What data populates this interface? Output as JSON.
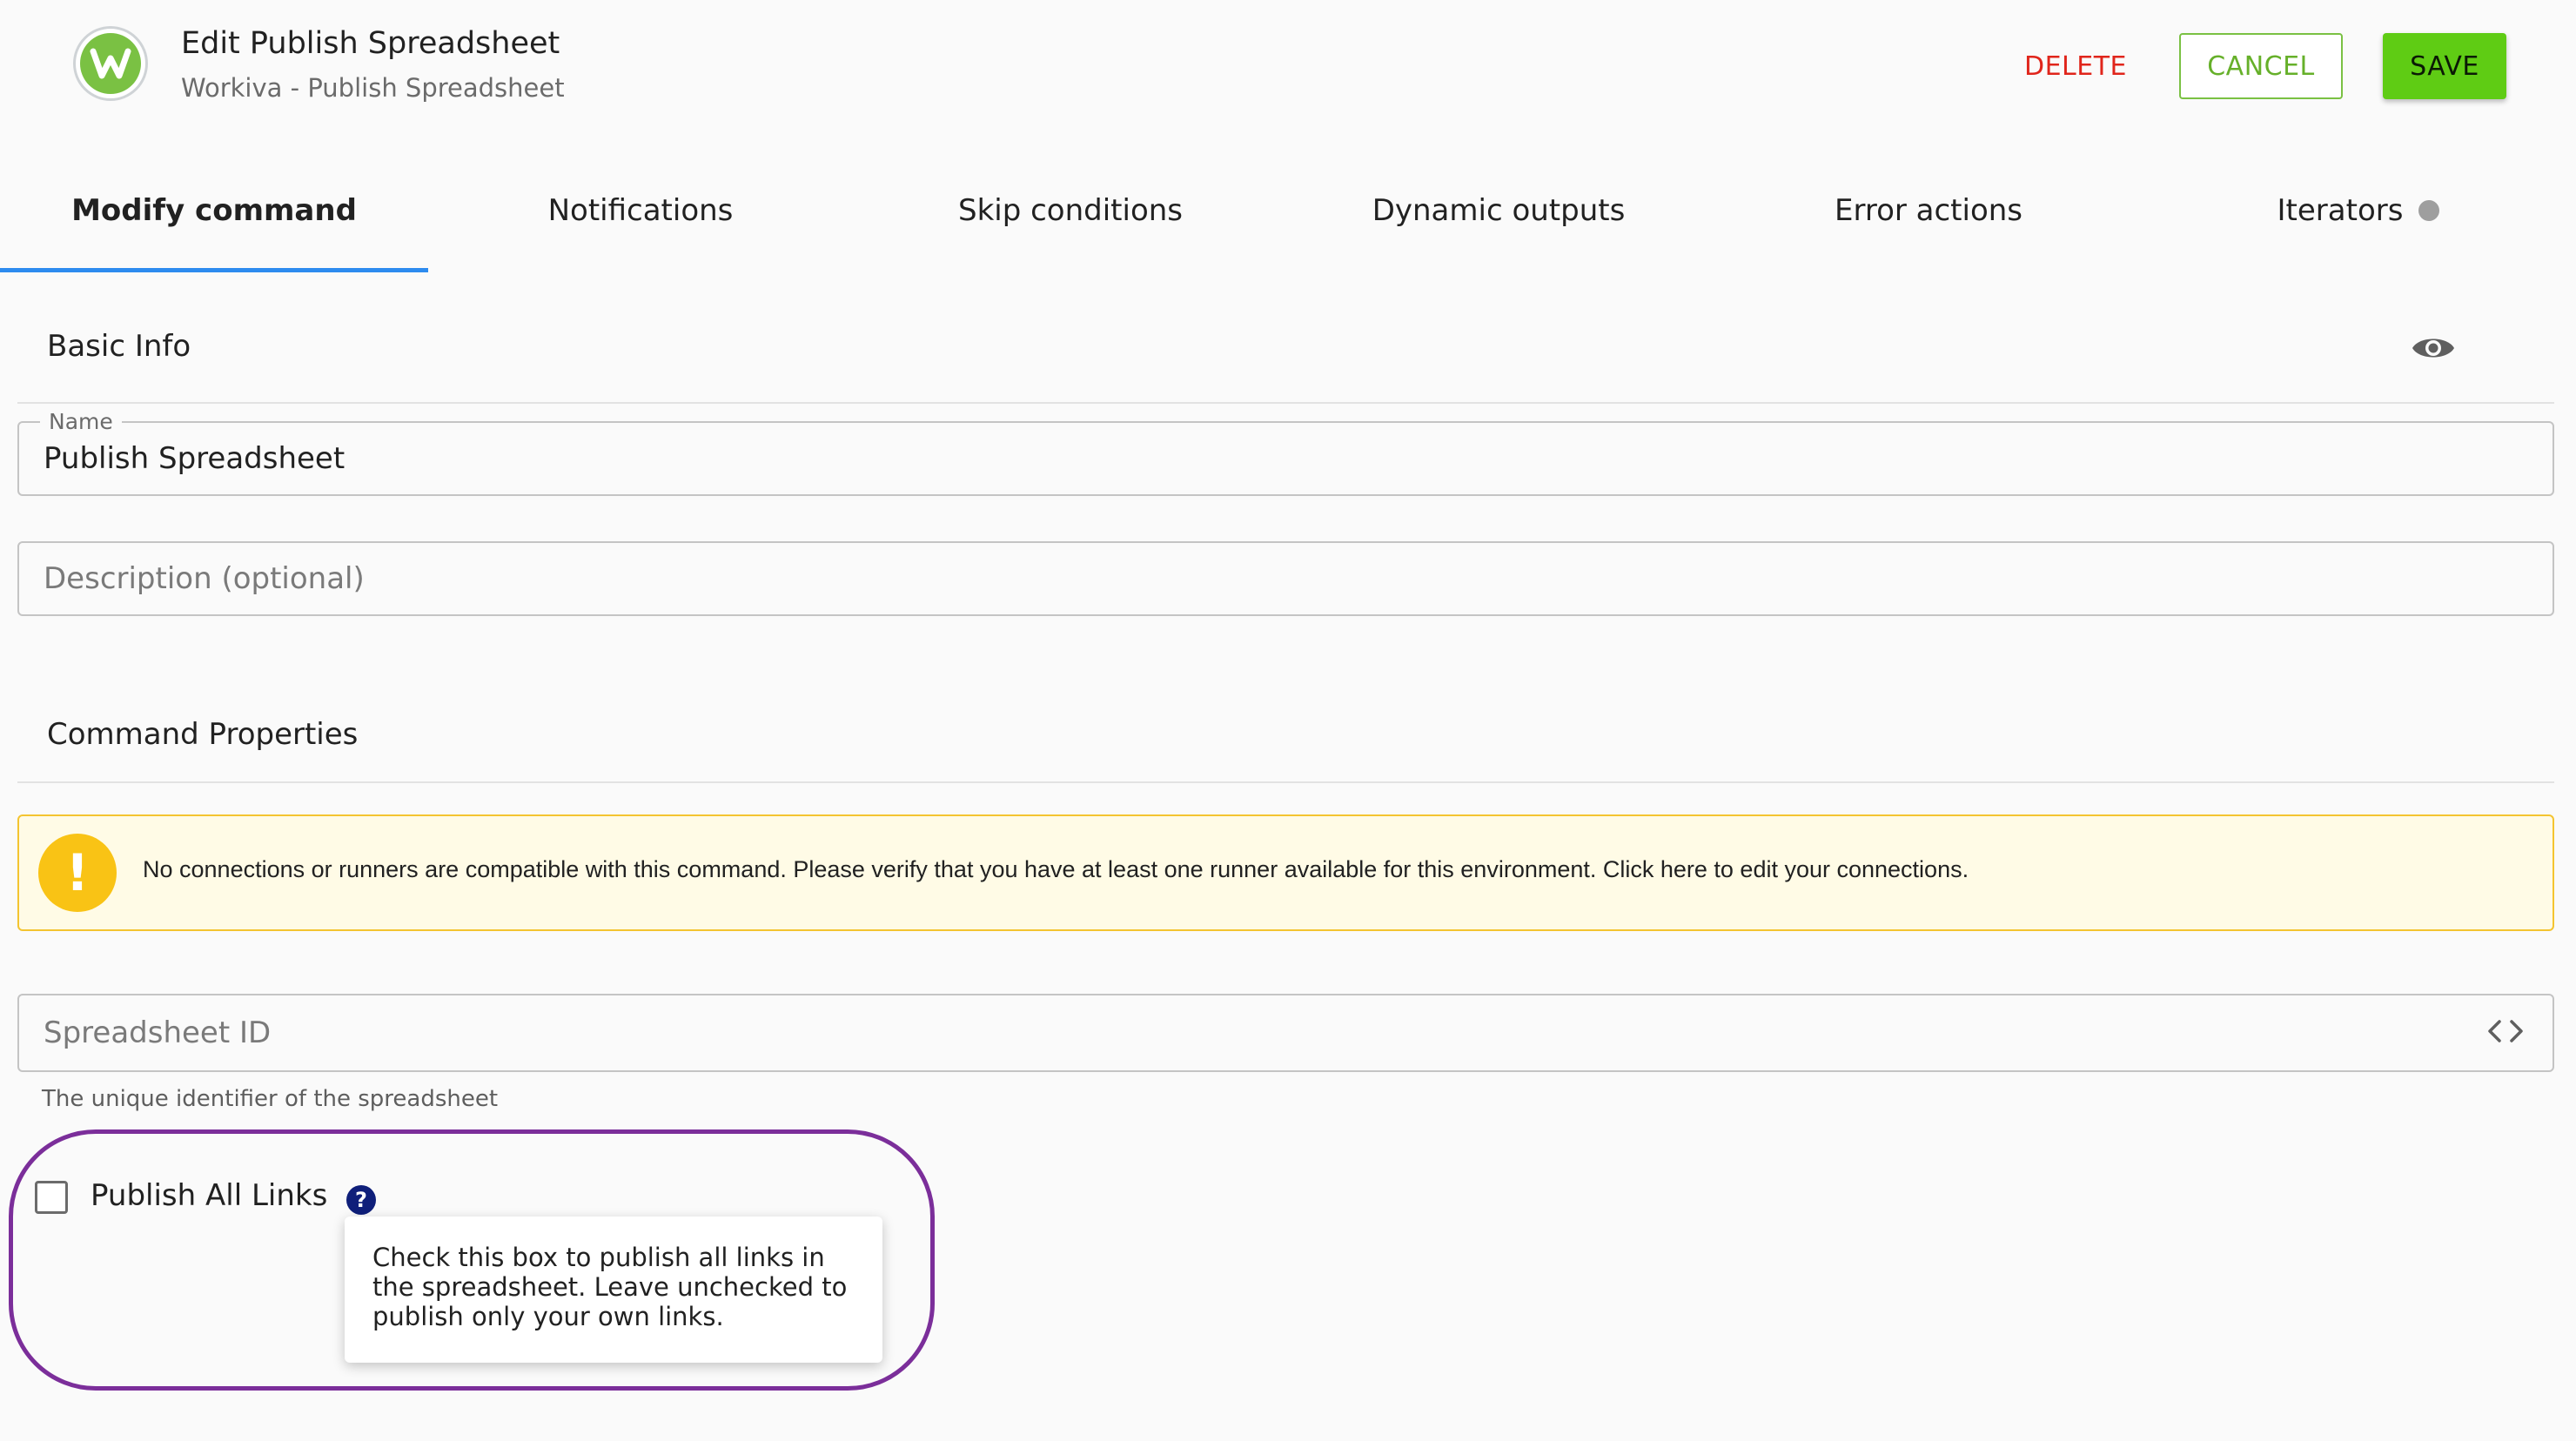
{
  "header": {
    "title": "Edit Publish Spreadsheet",
    "subtitle": "Workiva - Publish Spreadsheet",
    "logo_icon": "workiva-logo-icon",
    "delete_label": "DELETE",
    "cancel_label": "CANCEL",
    "save_label": "SAVE"
  },
  "tabs": [
    {
      "label": "Modify command",
      "active": true
    },
    {
      "label": "Notifications"
    },
    {
      "label": "Skip conditions"
    },
    {
      "label": "Dynamic outputs"
    },
    {
      "label": "Error actions"
    },
    {
      "label": "Iterators"
    }
  ],
  "basic_info": {
    "title": "Basic Info",
    "name_label": "Name",
    "name_value": "Publish Spreadsheet",
    "description_placeholder": "Description (optional)"
  },
  "command_properties": {
    "title": "Command Properties",
    "warning_text": "No connections or runners are compatible with this command. Please verify that you have at least one runner available for this environment. Click here to edit your connections.",
    "spreadsheet_id_placeholder": "Spreadsheet ID",
    "spreadsheet_id_helper": "The unique identifier of the spreadsheet",
    "publish_all_links_label": "Publish All Links",
    "publish_all_links_checked": false,
    "tooltip_text": "Check this box to publish all links in the spreadsheet. Leave unchecked to publish only your own links."
  },
  "colors": {
    "accent_blue": "#2d8bef",
    "delete_red": "#e0251b",
    "brand_green": "#5fcc14",
    "warning_yellow": "#f9c315",
    "highlight_purple": "#7b2e9a"
  }
}
